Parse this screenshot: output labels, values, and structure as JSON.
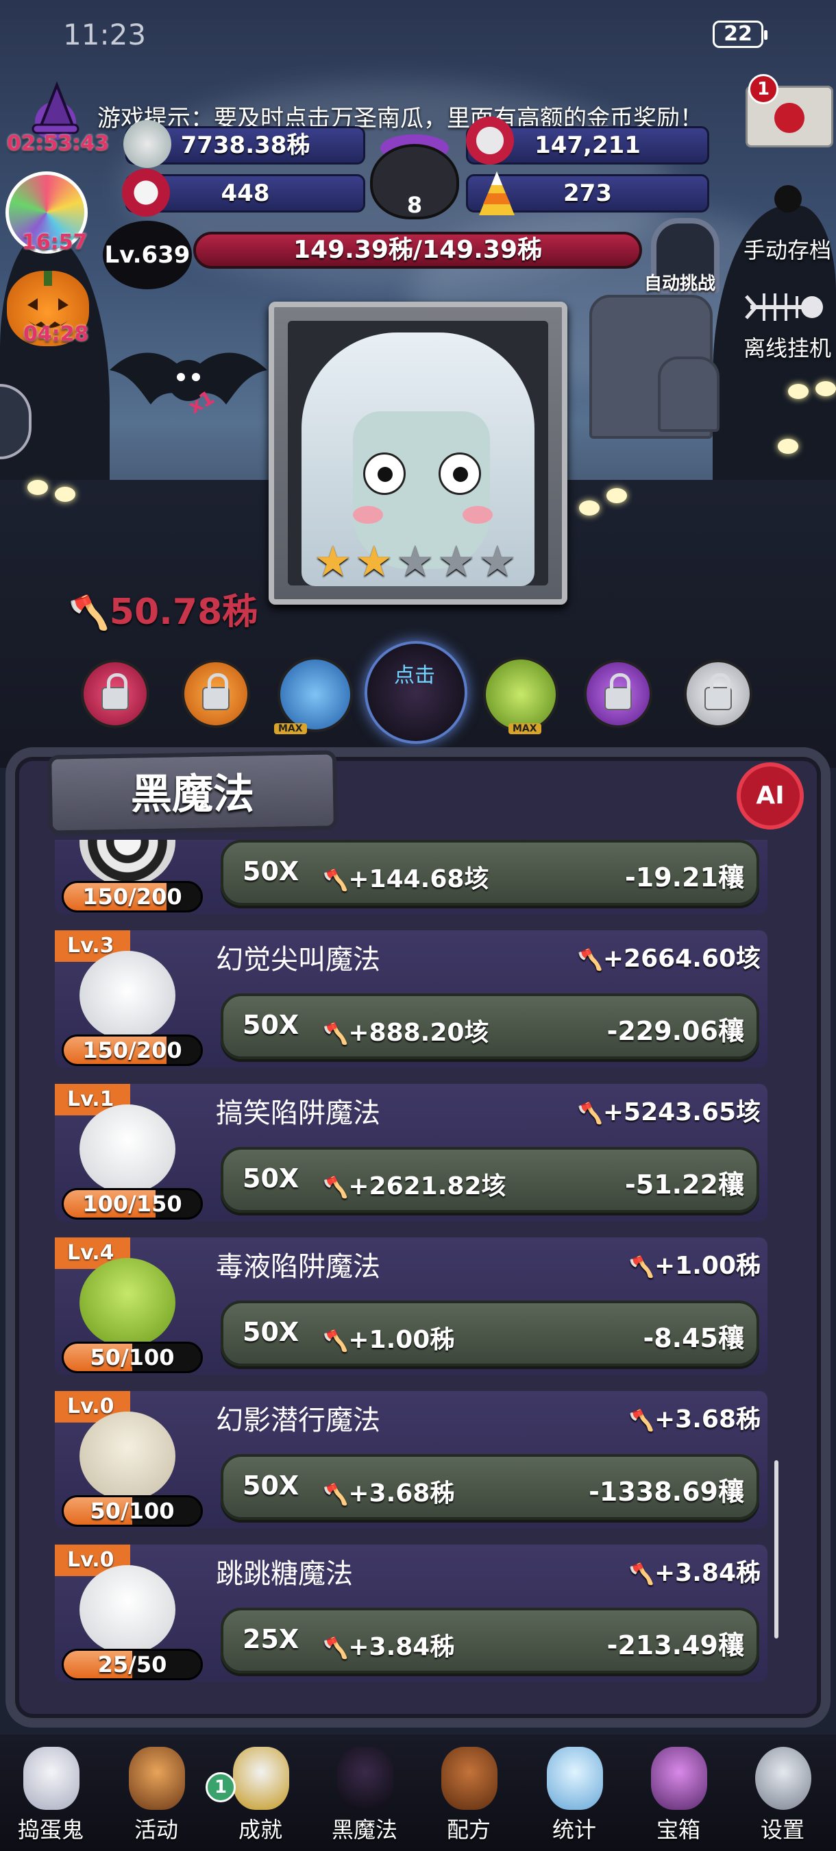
{
  "status_bar": {
    "time": "11:23",
    "battery": "22"
  },
  "tip": "游戏提示：要及时点击万圣南瓜，里面有高额的金币奖励！",
  "side_timers": {
    "witch": "02:53:43",
    "candy": "16:57",
    "pumpkin": "04:28"
  },
  "resources": {
    "coins": "7738.38秭",
    "souls": "147,211",
    "candy": "448",
    "corn_candy": "273",
    "cauldron": "8"
  },
  "level": "Lv.639",
  "hp": "149.39秭/149.39秭",
  "hp_fraction": 1.0,
  "auto_challenge": "自动挑战",
  "right_menu": {
    "manual_save": "手动存档",
    "offline": "离线挂机",
    "mail_badge": "1"
  },
  "boss_stars": {
    "filled": 2,
    "total": 5
  },
  "damage": "50.78秭",
  "click_label": "点击",
  "max_label": "MAX",
  "bat_multiplier": "x1",
  "panel": {
    "title": "黑魔法",
    "ai_badge": "AI"
  },
  "spells": [
    {
      "level": "",
      "name": "",
      "dps": "",
      "progress": "150/200",
      "progress_fraction": 0.75,
      "multiplier": "50X",
      "gain": "+144.68垓",
      "cost": "-19.21穰",
      "icon": "spiral-disc-icon"
    },
    {
      "level": "Lv.3",
      "name": "幻觉尖叫魔法",
      "dps": "+2664.60垓",
      "progress": "150/200",
      "progress_fraction": 0.75,
      "multiplier": "50X",
      "gain": "+888.20垓",
      "cost": "-229.06穰",
      "icon": "screaming-ghost-icon"
    },
    {
      "level": "Lv.1",
      "name": "搞笑陷阱魔法",
      "dps": "+5243.65垓",
      "progress": "100/150",
      "progress_fraction": 0.67,
      "multiplier": "50X",
      "gain": "+2621.82垓",
      "cost": "-51.22穰",
      "icon": "skull-icon"
    },
    {
      "level": "Lv.4",
      "name": "毒液陷阱魔法",
      "dps": "+1.00秭",
      "progress": "50/100",
      "progress_fraction": 0.5,
      "multiplier": "50X",
      "gain": "+1.00秭",
      "cost": "-8.45穰",
      "icon": "poison-zombie-icon"
    },
    {
      "level": "Lv.0",
      "name": "幻影潜行魔法",
      "dps": "+3.68秭",
      "progress": "50/100",
      "progress_fraction": 0.5,
      "multiplier": "50X",
      "gain": "+3.68秭",
      "cost": "-1338.69穰",
      "icon": "spider-egg-icon"
    },
    {
      "level": "Lv.0",
      "name": "跳跳糖魔法",
      "dps": "+3.84秭",
      "progress": "25/50",
      "progress_fraction": 0.5,
      "multiplier": "25X",
      "gain": "+3.84秭",
      "cost": "-213.49穰",
      "icon": "scream-mask-icon"
    }
  ],
  "nav": {
    "items": [
      {
        "label": "捣蛋鬼",
        "icon": "ghost-icon"
      },
      {
        "label": "活动",
        "icon": "cupcake-icon"
      },
      {
        "label": "成就",
        "icon": "skull-trophy-icon"
      },
      {
        "label": "黑魔法",
        "icon": "devil-icon"
      },
      {
        "label": "配方",
        "icon": "spellbook-icon"
      },
      {
        "label": "统计",
        "icon": "crystal-ball-icon"
      },
      {
        "label": "宝箱",
        "icon": "treasure-chest-icon"
      },
      {
        "label": "设置",
        "icon": "gear-icon"
      }
    ],
    "badge": "1"
  },
  "colors": {
    "accent_orange": "#e8742a",
    "hp_red": "#b52446",
    "panel_purple": "#2c2a45",
    "button_green": "#5a6657"
  }
}
